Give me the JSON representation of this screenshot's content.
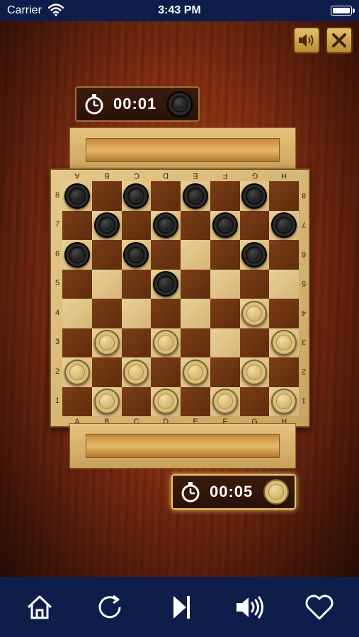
{
  "status_bar": {
    "carrier": "Carrier",
    "time": "3:43 PM"
  },
  "controls": {
    "sound_icon": "speaker-icon",
    "close_icon": "close-icon"
  },
  "timers": {
    "top": {
      "value": "00:01",
      "piece_color": "black"
    },
    "bottom": {
      "value": "00:05",
      "piece_color": "white",
      "active": true
    }
  },
  "board": {
    "files": [
      "A",
      "B",
      "C",
      "D",
      "E",
      "F",
      "G",
      "H"
    ],
    "ranks": [
      "8",
      "7",
      "6",
      "5",
      "4",
      "3",
      "2",
      "1"
    ],
    "colors": {
      "light": "#e0c488",
      "dark": "#6b3210"
    },
    "pieces": [
      {
        "color": "black",
        "square": "A8"
      },
      {
        "color": "black",
        "square": "C8"
      },
      {
        "color": "black",
        "square": "E8"
      },
      {
        "color": "black",
        "square": "G8"
      },
      {
        "color": "black",
        "square": "B7"
      },
      {
        "color": "black",
        "square": "D7"
      },
      {
        "color": "black",
        "square": "F7"
      },
      {
        "color": "black",
        "square": "H7"
      },
      {
        "color": "black",
        "square": "A6"
      },
      {
        "color": "black",
        "square": "C6"
      },
      {
        "color": "black",
        "square": "G6"
      },
      {
        "color": "black",
        "square": "D5"
      },
      {
        "color": "white",
        "square": "G4"
      },
      {
        "color": "white",
        "square": "B3"
      },
      {
        "color": "white",
        "square": "D3"
      },
      {
        "color": "white",
        "square": "H3"
      },
      {
        "color": "white",
        "square": "A2"
      },
      {
        "color": "white",
        "square": "C2"
      },
      {
        "color": "white",
        "square": "E2"
      },
      {
        "color": "white",
        "square": "G2"
      },
      {
        "color": "white",
        "square": "B1"
      },
      {
        "color": "white",
        "square": "D1"
      },
      {
        "color": "white",
        "square": "F1"
      },
      {
        "color": "white",
        "square": "H1"
      }
    ]
  },
  "bottom_nav": {
    "items": [
      {
        "icon": "home-icon"
      },
      {
        "icon": "restart-icon"
      },
      {
        "icon": "skip-icon"
      },
      {
        "icon": "volume-icon"
      },
      {
        "icon": "heart-icon"
      }
    ]
  }
}
